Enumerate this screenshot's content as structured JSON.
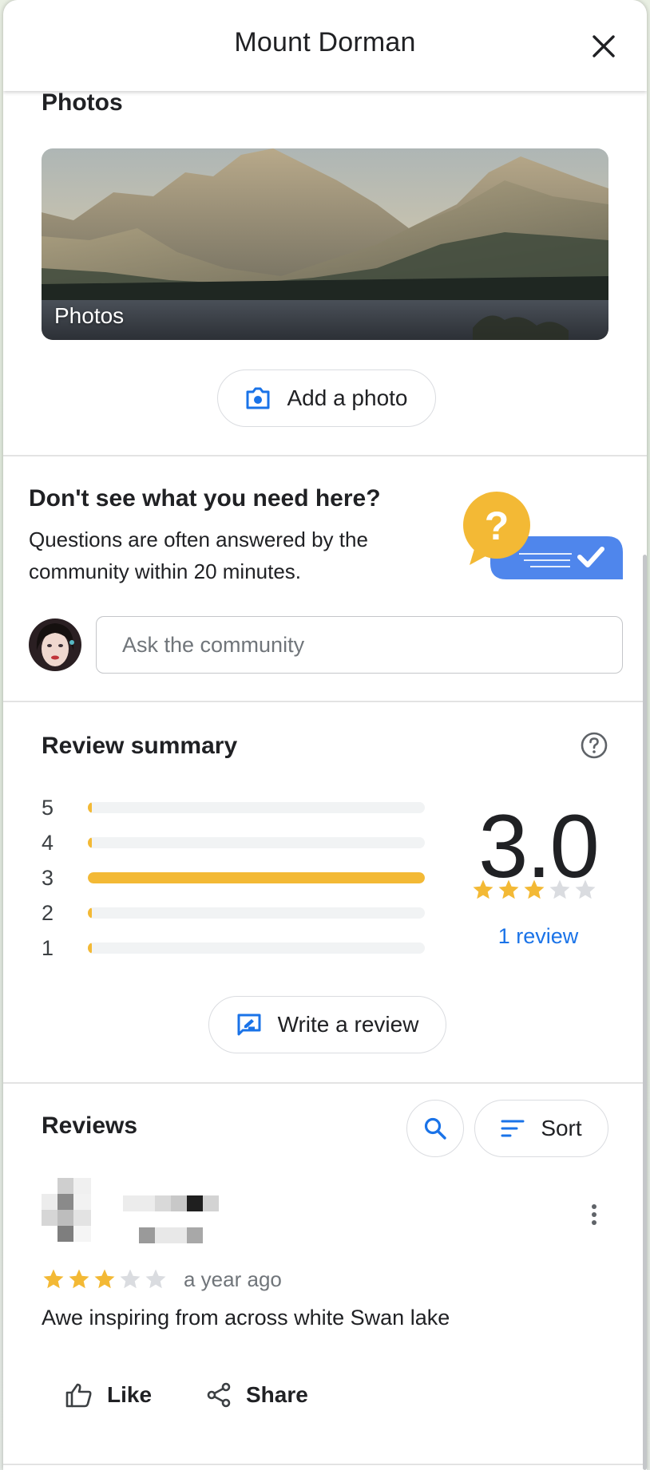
{
  "header": {
    "title": "Mount Dorman"
  },
  "photos": {
    "section_title": "Photos",
    "card_label": "Photos",
    "add_photo_label": "Add a photo"
  },
  "questions": {
    "title": "Don't see what you need here?",
    "subtitle": "Questions are often answered by the community within 20 minutes.",
    "ask_placeholder": "Ask the community"
  },
  "review_summary": {
    "title": "Review summary",
    "average": "3.0",
    "average_stars": 3,
    "max_stars": 5,
    "reviews_link": "1 review",
    "distribution": [
      {
        "stars": "5",
        "fraction": 0.0
      },
      {
        "stars": "4",
        "fraction": 0.0
      },
      {
        "stars": "3",
        "fraction": 1.0
      },
      {
        "stars": "2",
        "fraction": 0.0
      },
      {
        "stars": "1",
        "fraction": 0.0
      }
    ],
    "write_review_label": "Write a review"
  },
  "reviews": {
    "title": "Reviews",
    "sort_label": "Sort",
    "items": [
      {
        "rating": 3,
        "time": "a year ago",
        "text": "Awe inspiring from across white Swan lake",
        "like_label": "Like",
        "share_label": "Share"
      }
    ]
  },
  "colors": {
    "accent_blue": "#1a73e8",
    "star_yellow": "#f3b935",
    "star_empty": "#dadce0",
    "badge_yellow": "#f3b935",
    "bubble_blue": "#4f86ec"
  },
  "icons": {
    "close": "close-icon",
    "camera": "camera-icon",
    "help": "help-circle-icon",
    "write": "write-review-icon",
    "search": "search-icon",
    "sort": "sort-icon",
    "more": "more-vert-icon",
    "like": "thumb-up-icon",
    "share": "share-icon"
  }
}
